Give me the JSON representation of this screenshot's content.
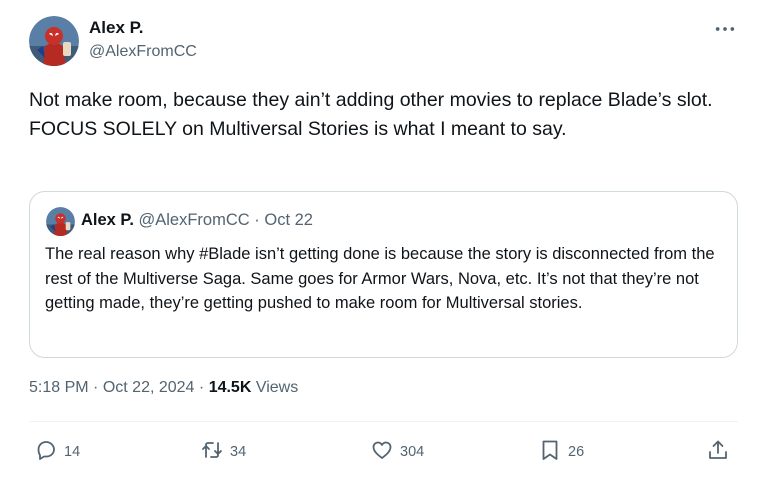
{
  "tweet": {
    "author_name": "Alex P.",
    "author_handle": "@AlexFromCC",
    "text": "Not make room, because they ain’t adding other movies to replace Blade’s slot. FOCUS SOLELY on Multiversal Stories is what I meant to say.",
    "time": "5:18 PM",
    "sep1": "·",
    "date": "Oct 22, 2024",
    "sep2": "·",
    "views_count": "14.5K",
    "views_label": "Views"
  },
  "quote": {
    "author_name": "Alex P.",
    "author_handle": "@AlexFromCC",
    "sep": "·",
    "date": "Oct 22",
    "text": "The real reason why #Blade isn’t getting done is because the story is disconnected from the rest of the Multiverse Saga. Same goes for Armor Wars, Nova, etc. It’s not that they’re not getting made, they’re getting pushed to make room for Multiversal stories."
  },
  "actions": {
    "replies": "14",
    "reposts": "34",
    "likes": "304",
    "bookmarks": "26"
  },
  "icons": {
    "more": "more-icon",
    "reply": "reply-icon",
    "repost": "repost-icon",
    "like": "heart-icon",
    "bookmark": "bookmark-icon",
    "share": "share-icon"
  },
  "colors": {
    "text_primary": "#0f1419",
    "text_secondary": "#536471",
    "border": "#cfd9de"
  }
}
